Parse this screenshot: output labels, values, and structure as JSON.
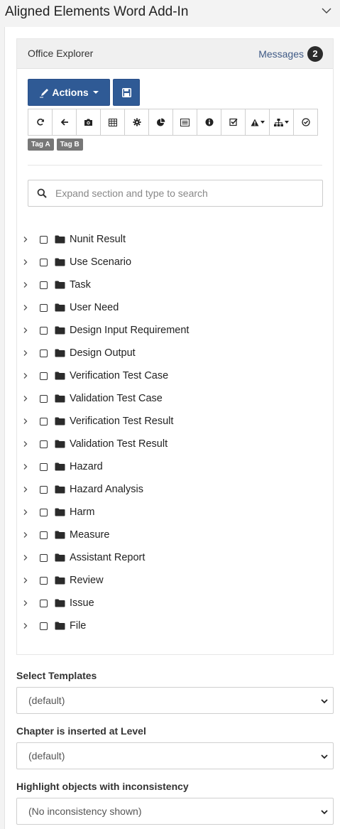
{
  "app": {
    "title": "Aligned Elements Word Add-In"
  },
  "explorer": {
    "title": "Office Explorer",
    "messages_label": "Messages",
    "messages_count": "2",
    "actions_label": "Actions",
    "toolbar_icons": [
      "refresh-icon",
      "back-arrow-icon",
      "camera-icon",
      "table-icon",
      "gear-icon",
      "pie-chart-icon",
      "list-view-icon",
      "info-icon",
      "checkbox-icon",
      "warning-dropdown-icon",
      "hierarchy-dropdown-icon",
      "check-circle-icon"
    ],
    "tags": [
      "Tag A",
      "Tag B"
    ],
    "search": {
      "placeholder": "Expand section and type to search",
      "value": ""
    },
    "tree": [
      "Nunit Result",
      "Use Scenario",
      "Task",
      "User Need",
      "Design Input Requirement",
      "Design Output",
      "Verification Test Case",
      "Validation Test Case",
      "Verification Test Result",
      "Validation Test Result",
      "Hazard",
      "Hazard Analysis",
      "Harm",
      "Measure",
      "Assistant Report",
      "Review",
      "Issue",
      "File"
    ]
  },
  "settings": {
    "templates_label": "Select Templates",
    "templates_value": "(default)",
    "level_label": "Chapter is inserted at Level",
    "level_value": "(default)",
    "inconsistency_label": "Highlight objects with inconsistency",
    "inconsistency_value": "(No inconsistency shown)"
  },
  "colors": {
    "primary": "#2f5a95",
    "link": "#3f5a86",
    "badge": "#2b2b2b",
    "tag": "#777777"
  }
}
